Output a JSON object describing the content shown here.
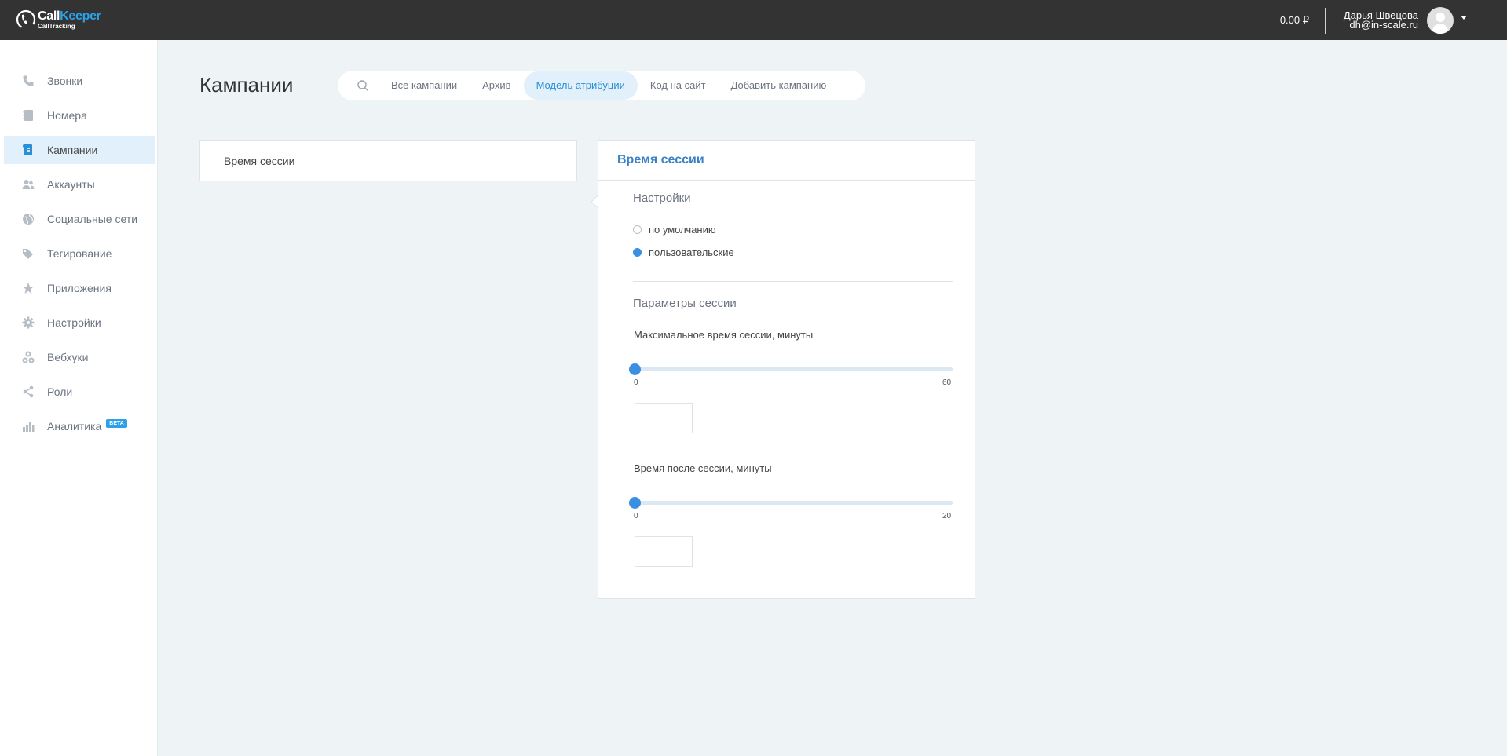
{
  "header": {
    "logo_call": "Call",
    "logo_keeper": "Keeper",
    "logo_sub": "CallTracking",
    "balance": "0.00 ₽",
    "user_name": "Дарья Швецова",
    "user_email": "dh@in-scale.ru"
  },
  "sidebar": {
    "items": [
      {
        "label": "Звонки",
        "icon": "phone-icon"
      },
      {
        "label": "Номера",
        "icon": "numbers-icon"
      },
      {
        "label": "Кампании",
        "icon": "campaigns-icon",
        "active": true
      },
      {
        "label": "Аккаунты",
        "icon": "accounts-icon"
      },
      {
        "label": "Социальные сети",
        "icon": "globe-icon"
      },
      {
        "label": "Тегирование",
        "icon": "tags-icon"
      },
      {
        "label": "Приложения",
        "icon": "apps-icon"
      },
      {
        "label": "Настройки",
        "icon": "gear-icon"
      },
      {
        "label": "Вебхуки",
        "icon": "webhooks-icon"
      },
      {
        "label": "Роли",
        "icon": "share-icon"
      },
      {
        "label": "Аналитика",
        "icon": "chart-icon",
        "badge": "BETA"
      }
    ]
  },
  "page": {
    "title": "Кампании",
    "tabs": [
      "Все кампании",
      "Архив",
      "Модель атрибуции",
      "Код на сайт",
      "Добавить кампанию"
    ],
    "active_tab": "Модель атрибуции"
  },
  "list": {
    "item": "Время сессии"
  },
  "detail": {
    "title": "Время сессии",
    "settings_label": "Настройки",
    "options": [
      {
        "label": "по умолчанию",
        "checked": false
      },
      {
        "label": "пользовательские",
        "checked": true
      }
    ],
    "params_label": "Параметры сессии",
    "sliders": [
      {
        "label": "Максимальное время сессии, минуты",
        "min": "0",
        "max": "60",
        "value": 0,
        "input_value": ""
      },
      {
        "label": "Время после сессии, минуты",
        "min": "0",
        "max": "20",
        "value": 0,
        "input_value": ""
      }
    ]
  },
  "colors": {
    "accent": "#3b8fe0",
    "topbar": "#333333",
    "active_bg": "#e1f0fb"
  }
}
